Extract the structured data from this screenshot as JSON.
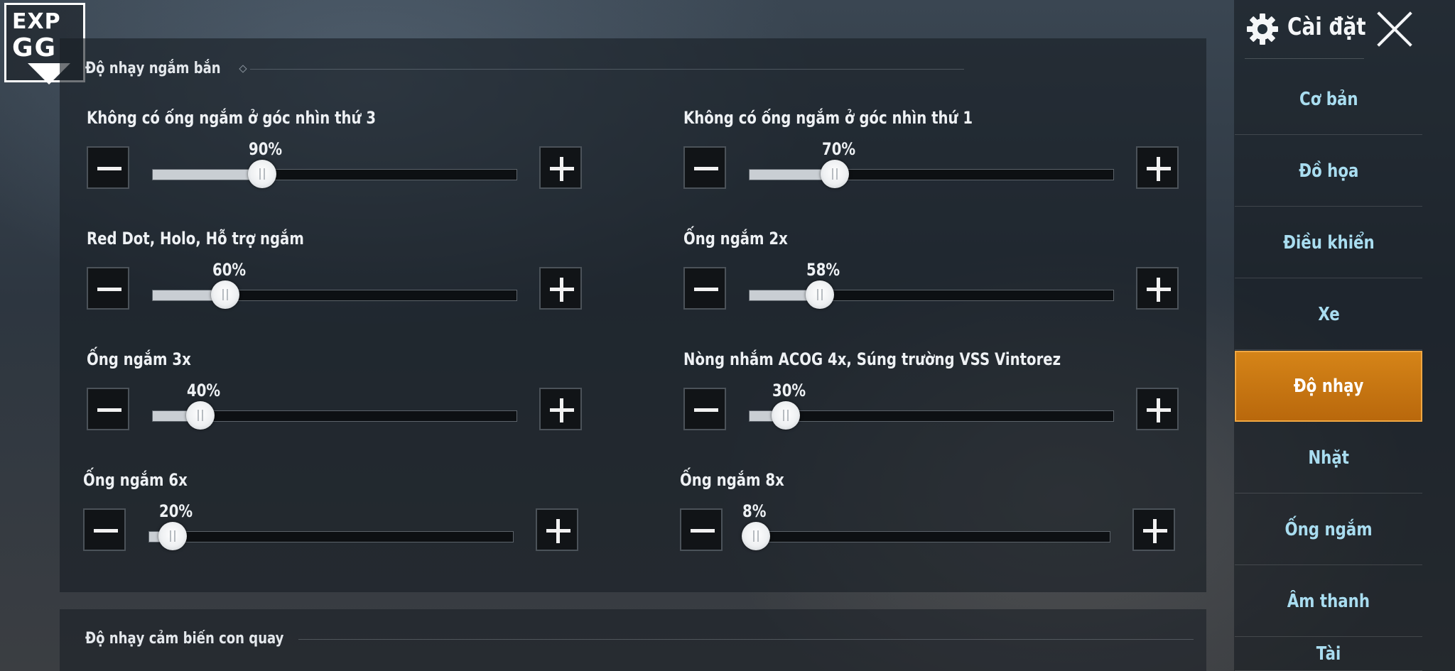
{
  "logo": {
    "line1": "EXP",
    "line2": "GG"
  },
  "section": {
    "title": "Độ nhạy ngắm bắn"
  },
  "settings": [
    {
      "label": "Không có ống ngắm ở góc nhìn thứ 3",
      "value": "90%",
      "level": 0.3
    },
    {
      "label": "Không có ống ngắm ở góc nhìn thứ 1",
      "value": "70%",
      "level": 0.235
    },
    {
      "label": "Red Dot, Holo, Hỗ trợ ngắm",
      "value": "60%",
      "level": 0.2
    },
    {
      "label": "Ống ngắm 2x",
      "value": "58%",
      "level": 0.193
    },
    {
      "label": "Ống ngắm 3x",
      "value": "40%",
      "level": 0.13
    },
    {
      "label": "Nòng nhắm ACOG 4x, Súng trường VSS Vintorez",
      "value": "30%",
      "level": 0.1
    },
    {
      "label": "Ống ngắm 6x",
      "value": "20%",
      "level": 0.065
    },
    {
      "label": "Ống ngắm 8x",
      "value": "8%",
      "level": 0.027
    }
  ],
  "section2": {
    "title": "Độ nhạy cảm biến con quay"
  },
  "sidebar": {
    "title": "Cài đặt",
    "items": [
      {
        "label": "Cơ bản"
      },
      {
        "label": "Đồ họa"
      },
      {
        "label": "Điều khiển"
      },
      {
        "label": "Xe"
      },
      {
        "label": "Độ nhạy",
        "active": true
      },
      {
        "label": "Nhặt"
      },
      {
        "label": "Ống ngắm"
      },
      {
        "label": "Âm thanh"
      },
      {
        "label": "Tài"
      }
    ]
  },
  "colors": {
    "accent": "#c87812",
    "nav_text": "#a9ddf0"
  }
}
